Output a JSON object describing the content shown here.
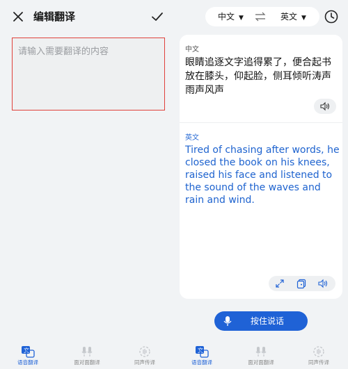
{
  "left": {
    "header": {
      "title": "编辑翻译"
    },
    "input": {
      "placeholder": "请输入需要翻译的内容",
      "value": ""
    },
    "bottom_nav": [
      {
        "label": "语音翻译",
        "icon": "voice-translate-icon",
        "active": true
      },
      {
        "label": "面对面翻译",
        "icon": "face-to-face-icon",
        "active": false
      },
      {
        "label": "同声传译",
        "icon": "simultaneous-icon",
        "active": false
      }
    ]
  },
  "right": {
    "languages": {
      "source": "中文",
      "target": "英文"
    },
    "source": {
      "label": "中文",
      "text": "眼睛追逐文字追得累了，便合起书放在膝头，仰起脸，侧耳倾听涛声雨声风声"
    },
    "target": {
      "label": "英文",
      "text": "Tired of chasing after words, he closed the book on his knees, raised his face and listened to the sound of the waves and rain and wind."
    },
    "hold_button": {
      "label": "按住说话"
    },
    "bottom_nav": [
      {
        "label": "语音翻译",
        "icon": "voice-translate-icon",
        "active": true
      },
      {
        "label": "面对面翻译",
        "icon": "face-to-face-icon",
        "active": false
      },
      {
        "label": "同声传译",
        "icon": "simultaneous-icon",
        "active": false
      }
    ]
  },
  "colors": {
    "accent": "#1f62d6",
    "highlight_border": "#e0403a",
    "background": "#f1f3f5"
  }
}
